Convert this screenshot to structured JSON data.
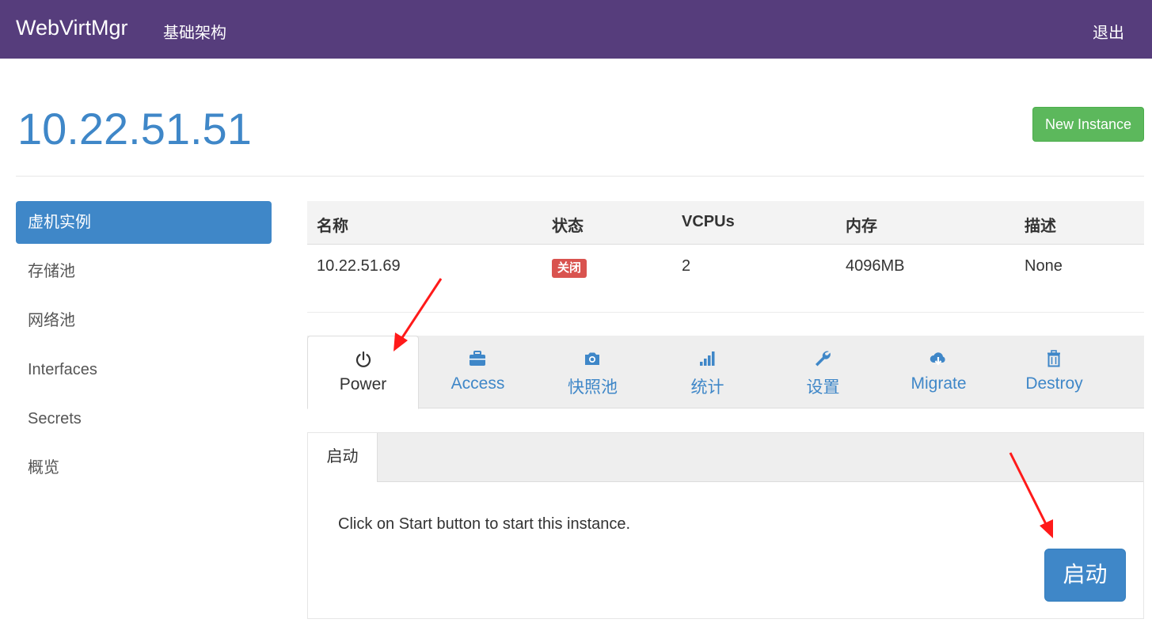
{
  "navbar": {
    "brand": "WebVirtMgr",
    "infrastructure": "基础架构",
    "logout": "退出"
  },
  "header": {
    "title": "10.22.51.51",
    "new_instance_label": "New Instance"
  },
  "sidebar": {
    "items": [
      {
        "label": "虚机实例",
        "active": true
      },
      {
        "label": "存储池"
      },
      {
        "label": "网络池"
      },
      {
        "label": "Interfaces"
      },
      {
        "label": "Secrets"
      },
      {
        "label": "概览"
      }
    ]
  },
  "table": {
    "headers": [
      "名称",
      "状态",
      "VCPUs",
      "内存",
      "描述"
    ],
    "rows": [
      {
        "name": "10.22.51.69",
        "status": "关闭",
        "vcpus": "2",
        "memory": "4096MB",
        "description": "None"
      }
    ]
  },
  "tabs": [
    {
      "label": "Power",
      "icon": "power-icon",
      "active": true
    },
    {
      "label": "Access",
      "icon": "briefcase-icon"
    },
    {
      "label": "快照池",
      "icon": "camera-icon"
    },
    {
      "label": "统计",
      "icon": "signal-bars-icon"
    },
    {
      "label": "设置",
      "icon": "wrench-icon"
    },
    {
      "label": "Migrate",
      "icon": "cloud-download-icon"
    },
    {
      "label": "Destroy",
      "icon": "trash-icon"
    }
  ],
  "power_panel": {
    "subtab_label": "启动",
    "message": "Click on Start button to start this instance.",
    "start_button_label": "启动"
  },
  "colors": {
    "navbar": "#563d7c",
    "primary": "#3f87c8",
    "success": "#5cb85c",
    "danger": "#d9534f",
    "annotation": "#ff1a1a"
  }
}
